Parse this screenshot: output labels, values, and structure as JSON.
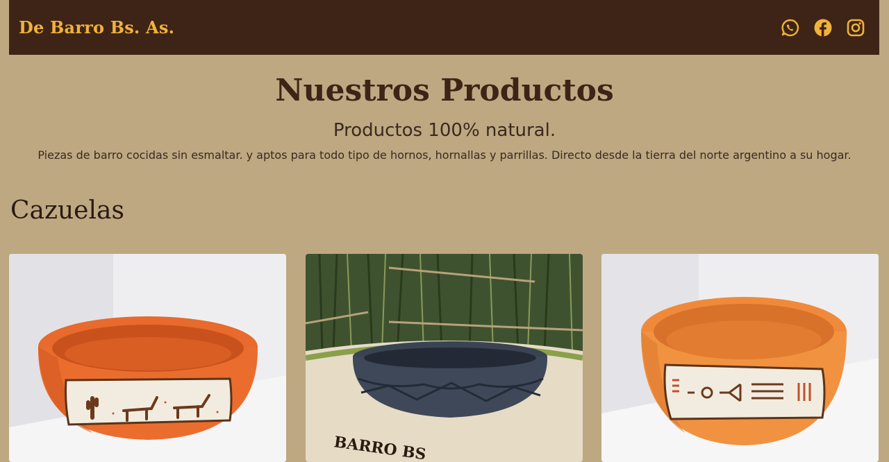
{
  "navbar": {
    "brand": "De Barro Bs. As.",
    "social_links": [
      {
        "icon": "whatsapp-icon"
      },
      {
        "icon": "facebook-icon"
      },
      {
        "icon": "instagram-icon"
      }
    ]
  },
  "colors": {
    "page_background": "#bda882",
    "navbar_background": "#3e2416",
    "brand_accent": "#f0b23c",
    "heading_brown": "#3e2416"
  },
  "hero": {
    "title": "Nuestros Productos",
    "subtitle": "Productos 100% natural.",
    "description": "Piezas de barro cocidas sin esmaltar. y aptos para todo tipo de hornos, hornallas y parrillas. Directo desde la tierra del norte argentino a su hogar."
  },
  "section": {
    "title": "Cazuelas",
    "products": [
      {
        "image": "terracotta-bowl-with-cactus-and-llama-design"
      },
      {
        "image": "black-clay-bowl-with-mountain-relief",
        "logo_text": "BARRO BS"
      },
      {
        "image": "orange-clay-bowl-with-sun-and-fish-design"
      }
    ]
  }
}
